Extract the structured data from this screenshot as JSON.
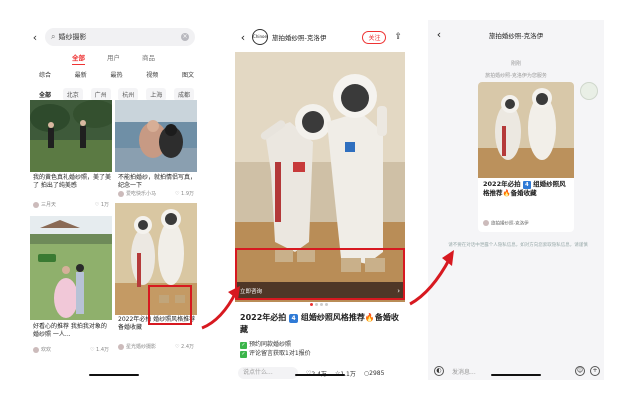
{
  "phone1": {
    "search": {
      "back_icon": "chevron-left-icon",
      "query": "婚纱摄影",
      "clear_icon": "clear-icon"
    },
    "tabs": [
      "全部",
      "用户",
      "商品"
    ],
    "active_tab": "全部",
    "filters": [
      "综合",
      "最新",
      "最热",
      "视频",
      "图文"
    ],
    "chips": [
      "全部",
      "北京",
      "广州",
      "杭州",
      "上海",
      "成都"
    ],
    "active_chip": "全部",
    "cards": [
      {
        "caption": "我的黄色真礼婚纱照，美了美了 拍出了纯美感",
        "author": "三月天",
        "likes": "1万"
      },
      {
        "caption": "不能拍婚纱，就拍情侣写真，纪念一下",
        "author": "爱吃快乐小马",
        "likes": "1.9万"
      },
      {
        "caption": "好看心的推荐 我拍我对象的婚纱照 一人...",
        "author": "欢欢",
        "likes": "1.4万"
      },
      {
        "caption": "2022年必拍 婚纱照风格推荐 备婚收藏",
        "author": "星光婚纱摄影",
        "likes": "2.4万"
      }
    ]
  },
  "phone2": {
    "back_icon": "chevron-left-icon",
    "shop_logo": "Chinoe",
    "shop_name": "旅拍婚纱照-克洛伊",
    "follow": "关注",
    "share_icon": "share-icon",
    "consult": "立即咨询",
    "title_pre": "2022年必拍",
    "title_num": "4",
    "title_post": "组婚纱照风格推荐🔥备婚收藏",
    "bullets": [
      "预约同款婚纱照",
      "评论留言获取1对1报价"
    ],
    "say_placeholder": "说点什么...",
    "likes": "2.4万",
    "stars": "1.1万",
    "comments": "2985"
  },
  "phone3": {
    "back_icon": "chevron-left-icon",
    "chat_title": "旅拍婚纱照-克洛伊",
    "time": "刚刚",
    "sub": "旅拍婚纱照-克洛伊为您服务",
    "shared_title_pre": "2022年必拍",
    "shared_num": "4",
    "shared_title_post": "组婚纱照风格推荐🔥备婚收藏",
    "shared_source": "旅拍婚纱照-克洛伊",
    "notice": "请不要在对话中泄露个人隐私信息，如对方向您索取隐私信息，请谨慎",
    "input_placeholder": "发消息..."
  },
  "colors": {
    "highlight": "#d71920",
    "accent": "#e33333"
  }
}
